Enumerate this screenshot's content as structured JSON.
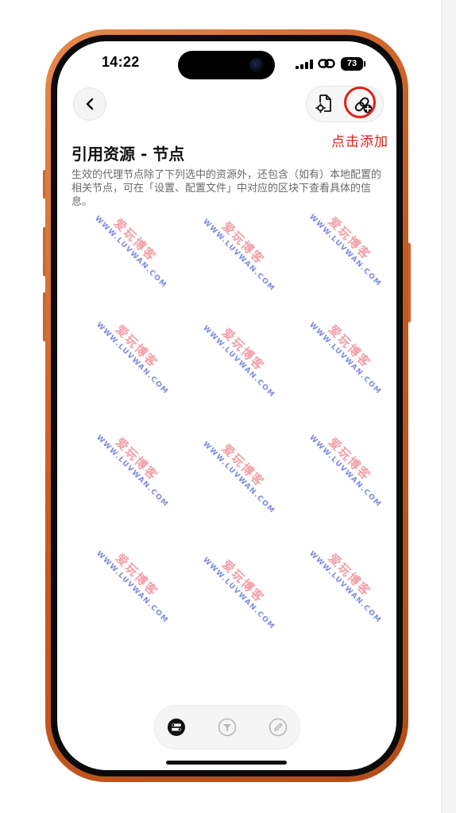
{
  "status_bar": {
    "time": "14:22",
    "battery": "73"
  },
  "nav": {
    "back_icon": "chevron-left-icon",
    "file_settings_icon": "file-gear-icon",
    "add_link_icon": "link-plus-icon"
  },
  "annotation": {
    "label": "点击添加",
    "color": "#e0201b"
  },
  "page": {
    "title": "引用资源 - 节点",
    "description": "生效的代理节点除了下列选中的资源外，还包含（如有）本地配置的相关节点，可在「设置、配置文件」中对应的区块下查看具体的信息。"
  },
  "watermark": {
    "cn": "爱玩博客",
    "en": "WWW.LUVWAN.COM"
  },
  "toolbar": {
    "items": [
      {
        "icon": "toggle-list-icon",
        "active": true
      },
      {
        "icon": "filter-icon",
        "active": false
      },
      {
        "icon": "edit-icon",
        "active": false
      }
    ]
  },
  "colors": {
    "frame": "#c65a20",
    "accent_red": "#e0201b",
    "text_primary": "#111111",
    "text_secondary": "#6a6a6a"
  }
}
